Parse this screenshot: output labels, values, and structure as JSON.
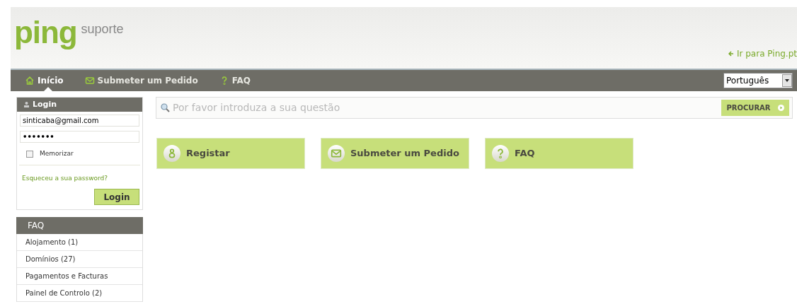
{
  "header": {
    "logo": "ping",
    "subtitle": "suporte",
    "back_link": "Ir para Ping.pt"
  },
  "nav": [
    {
      "label": "Início",
      "kind": "home",
      "selected": true
    },
    {
      "label": "Submeter um Pedido",
      "kind": "mail",
      "selected": false
    },
    {
      "label": "FAQ",
      "kind": "question",
      "selected": false
    }
  ],
  "language": {
    "value": "Português"
  },
  "login": {
    "title": "Login",
    "email": "sinticaba@gmail.com",
    "password": "•••••••",
    "remember": {
      "label": "Memorizar",
      "checked": false
    },
    "forgot": "Esqueceu a sua password?",
    "button": "Login"
  },
  "faq": {
    "title": "FAQ",
    "items": [
      "Alojamento (1)",
      "Domínios (27)",
      "Pagamentos e Facturas",
      "Painel de Controlo (2)"
    ]
  },
  "search": {
    "placeholder": "Por favor introduza a sua questão",
    "button": "PROCURAR"
  },
  "tiles": [
    {
      "label": "Registar",
      "kind": "person"
    },
    {
      "label": "Submeter um Pedido",
      "kind": "mail"
    },
    {
      "label": "FAQ",
      "kind": "question"
    }
  ]
}
